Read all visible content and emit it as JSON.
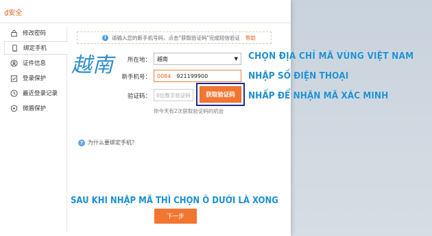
{
  "window": {
    "title": "₫安全"
  },
  "sidebar": {
    "items": [
      {
        "label": "修改密码",
        "icon": "lock-icon"
      },
      {
        "label": "绑定手机",
        "icon": "phone-icon",
        "active": true
      },
      {
        "label": "证件信息",
        "icon": "id-card-icon"
      },
      {
        "label": "登录保护",
        "icon": "shield-check-icon"
      },
      {
        "label": "最近登录记录",
        "icon": "clock-icon"
      },
      {
        "label": "微盾保护",
        "icon": "badge-icon"
      }
    ]
  },
  "info": {
    "text": "请输入您的新手机号码，点击\"获取验证码\"完成短信验证",
    "help": "帮助"
  },
  "overlay_hanzi": "越南",
  "form": {
    "region_label": "所在地：",
    "region_value": "越南",
    "phone_label": "新手机号：",
    "phone_country_code": "0084",
    "phone_number": "921199900",
    "code_label": "验证码：",
    "code_placeholder": "6位数字验证码",
    "get_code_button": "获取验证码",
    "tip": "你今天有2次获取验证码的机会"
  },
  "why_link": "为什么要绑定手机？",
  "next_button": "下一步",
  "annotations": {
    "step1": "CHỌN ĐỊA CHỈ MÃ VÙNG VIỆT NAM",
    "step2": "NHẬP SỐ ĐIỆN THOẠI",
    "step3": "NHẤP ĐỂ NHẬN MÃ XÁC MINH",
    "step4": "SAU KHI NHẬP MÃ THÌ CHỌN Ô DƯỚI LÀ XONG"
  },
  "colors": {
    "accent": "#f27632",
    "annotation": "#1f8fd1",
    "highlight_frame": "#1d2a8c"
  }
}
